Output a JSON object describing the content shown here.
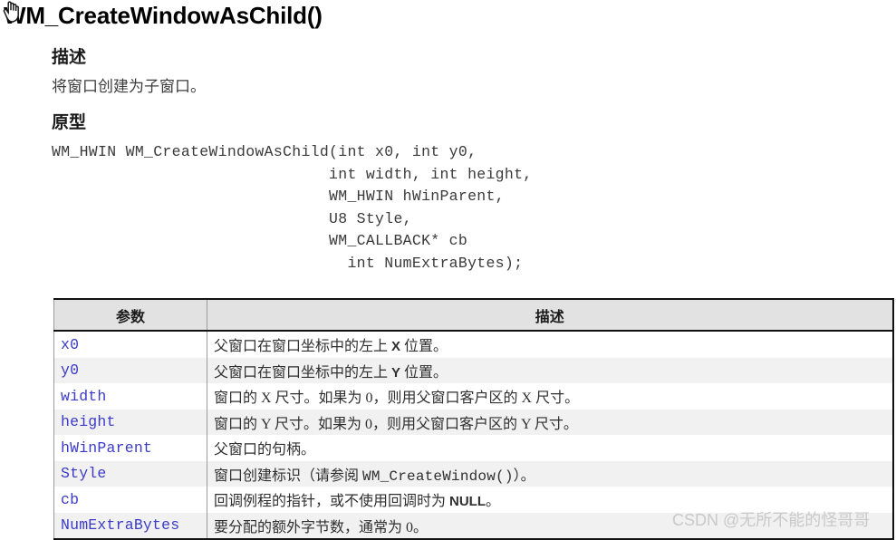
{
  "title": "WM_CreateWindowAsChild()",
  "cursor": {
    "icon": "hand-cursor-icon"
  },
  "sections": {
    "description": {
      "heading": "描述",
      "body": "将窗口创建为子窗口。"
    },
    "prototype": {
      "heading": "原型",
      "code": "WM_HWIN WM_CreateWindowAsChild(int x0, int y0,\n                              int width, int height,\n                              WM_HWIN hWinParent,\n                              U8 Style,\n                              WM_CALLBACK* cb\n                                int NumExtraBytes);"
    }
  },
  "param_table": {
    "columns": [
      "参数",
      "描述"
    ],
    "rows": [
      {
        "name": "x0",
        "desc_pre": "父窗口在窗口坐标中的左上 ",
        "latin": "X",
        "desc_post": " 位置。",
        "mono": ""
      },
      {
        "name": "y0",
        "desc_pre": "父窗口在窗口坐标中的左上 ",
        "latin": "Y",
        "desc_post": " 位置。",
        "mono": ""
      },
      {
        "name": "width",
        "desc_pre": "窗口的 X 尺寸。如果为 0，则用父窗口客户区的 X 尺寸。",
        "latin": "",
        "desc_post": "",
        "mono": ""
      },
      {
        "name": "height",
        "desc_pre": "窗口的 Y 尺寸。如果为 0，则用父窗口客户区的 Y 尺寸。",
        "latin": "",
        "desc_post": "",
        "mono": ""
      },
      {
        "name": "hWinParent",
        "desc_pre": "父窗口的句柄。",
        "latin": "",
        "desc_post": "",
        "mono": ""
      },
      {
        "name": "Style",
        "desc_pre": "窗口创建标识（请参阅 ",
        "latin": "",
        "mono": "WM_CreateWindow()",
        "desc_post": "）。"
      },
      {
        "name": "cb",
        "desc_pre": "回调例程的指针，或不使用回调时为 ",
        "latin": "NULL",
        "desc_post": "。",
        "mono": ""
      },
      {
        "name": "NumExtraBytes",
        "desc_pre": "要分配的额外字节数，通常为 0。",
        "latin": "",
        "desc_post": "",
        "mono": ""
      }
    ]
  },
  "watermark": "CSDN @无所不能的怪哥哥",
  "colors": {
    "param_name": "#3b3bc8",
    "table_header_bg": "#e2e2e2",
    "row_alt_bg": "#f1f1f1",
    "border_dark": "#111111",
    "border_light": "#9a9a9a",
    "watermark": "#c9c9c9"
  }
}
